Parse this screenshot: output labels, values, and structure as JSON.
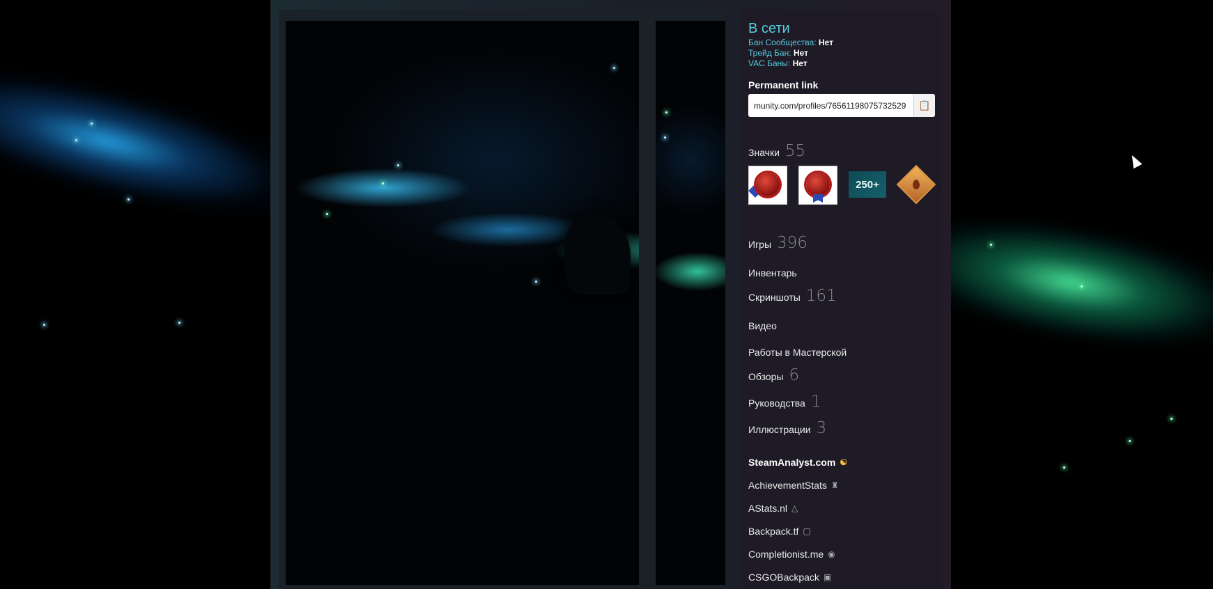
{
  "status": {
    "online": "В сети",
    "community_ban_label": "Бан Сообщества:",
    "community_ban_value": "Нет",
    "trade_ban_label": "Трейд Бан:",
    "trade_ban_value": "Нет",
    "vac_ban_label": "VAC Баны:",
    "vac_ban_value": "Нет"
  },
  "permanent_link": {
    "label": "Permanent link",
    "value": "munity.com/profiles/76561198075732529"
  },
  "badges": {
    "label": "Значки",
    "count": "55",
    "badge3_text": "250+"
  },
  "stats": [
    {
      "label": "Игры",
      "count": "396"
    },
    {
      "label": "Инвентарь",
      "count": ""
    },
    {
      "label": "Скриншоты",
      "count": "161"
    },
    {
      "label": "Видео",
      "count": ""
    },
    {
      "label": "Работы в Мастерской",
      "count": ""
    },
    {
      "label": "Обзоры",
      "count": "6"
    },
    {
      "label": "Руководства",
      "count": "1"
    },
    {
      "label": "Иллюстрации",
      "count": "3"
    }
  ],
  "external_links": [
    {
      "label": "SteamAnalyst.com",
      "icon": "steamanalyst-icon"
    },
    {
      "label": "AchievementStats",
      "icon": "achievementstats-icon"
    },
    {
      "label": "AStats.nl",
      "icon": "astats-icon"
    },
    {
      "label": "Backpack.tf",
      "icon": "backpacktf-icon"
    },
    {
      "label": "Completionist.me",
      "icon": "completionist-icon"
    },
    {
      "label": "CSGOBackpack",
      "icon": "csgobackpack-icon"
    }
  ],
  "colors": {
    "accent": "#57cbde",
    "count": "#898989"
  }
}
